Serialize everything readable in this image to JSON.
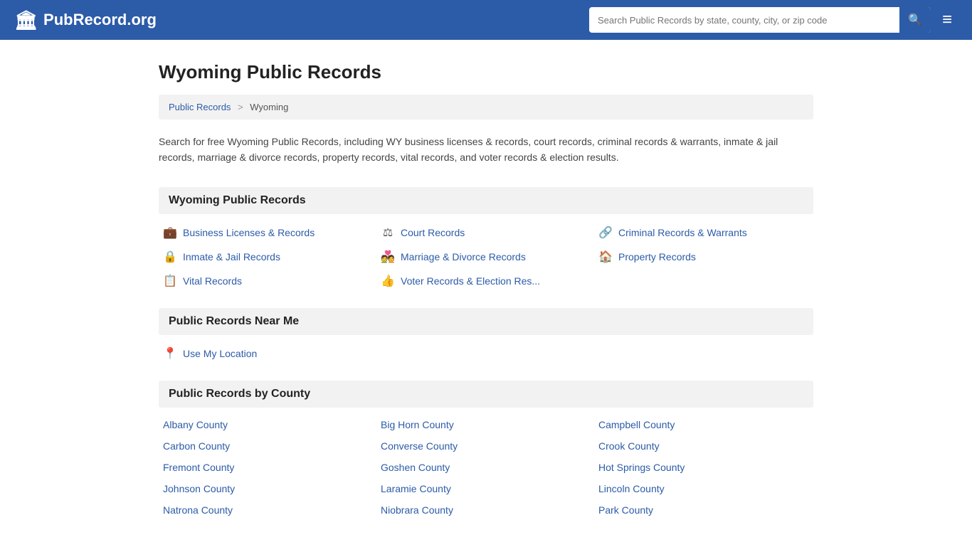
{
  "header": {
    "logo_icon": "🏛",
    "logo_text": "PubRecord.org",
    "search_placeholder": "Search Public Records by state, county, city, or zip code",
    "search_icon": "🔍",
    "menu_icon": "≡"
  },
  "page": {
    "title": "Wyoming Public Records",
    "breadcrumb": {
      "home": "Public Records",
      "separator": ">",
      "current": "Wyoming"
    },
    "description": "Search for free Wyoming Public Records, including WY business licenses & records, court records, criminal records & warrants, inmate & jail records, marriage & divorce records, property records, vital records, and voter records & election results."
  },
  "sections": {
    "records": {
      "title": "Wyoming Public Records",
      "items": [
        {
          "icon": "💼",
          "label": "Business Licenses & Records"
        },
        {
          "icon": "⚖",
          "label": "Court Records"
        },
        {
          "icon": "🔗",
          "label": "Criminal Records & Warrants"
        },
        {
          "icon": "🔒",
          "label": "Inmate & Jail Records"
        },
        {
          "icon": "💑",
          "label": "Marriage & Divorce Records"
        },
        {
          "icon": "🏠",
          "label": "Property Records"
        },
        {
          "icon": "📋",
          "label": "Vital Records"
        },
        {
          "icon": "👍",
          "label": "Voter Records & Election Res..."
        }
      ]
    },
    "near_me": {
      "title": "Public Records Near Me",
      "location_icon": "📍",
      "location_label": "Use My Location"
    },
    "counties": {
      "title": "Public Records by County",
      "items": [
        "Albany County",
        "Big Horn County",
        "Campbell County",
        "Carbon County",
        "Converse County",
        "Crook County",
        "Fremont County",
        "Goshen County",
        "Hot Springs County",
        "Johnson County",
        "Laramie County",
        "Lincoln County",
        "Natrona County",
        "Niobrara County",
        "Park County"
      ]
    }
  }
}
